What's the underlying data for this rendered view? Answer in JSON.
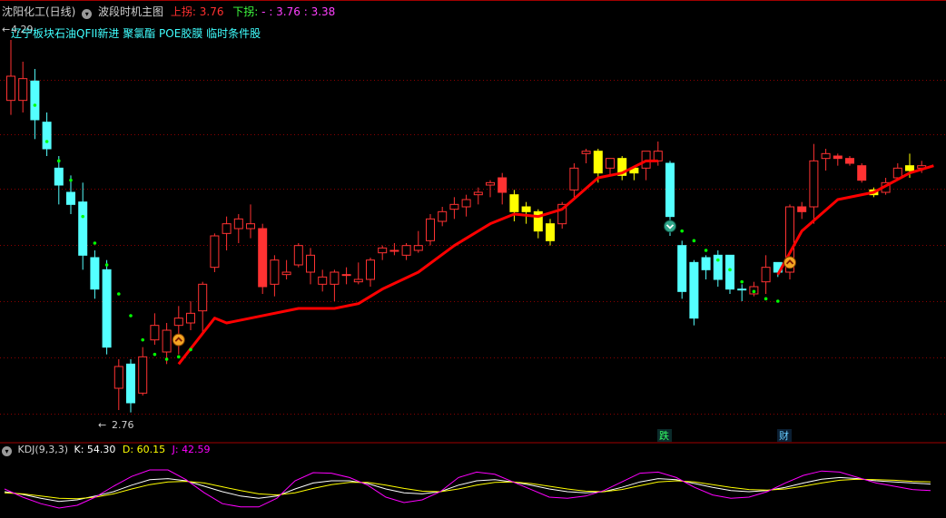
{
  "header": {
    "stock_name": "沈阳化工(日线)",
    "indicator_name": "波段时机主图",
    "up_label": "上拐:",
    "up_value": "3.76",
    "down_label": "下拐:",
    "down_value": "- : 3.76 : 3.38",
    "concept_tags": "辽宁板块石油QFII新进 聚氯酯 POE胶膜 临时条件股"
  },
  "main_chart": {
    "high_label": "4.29",
    "low_label": "2.76",
    "signal_labels": [
      "跌",
      "财"
    ]
  },
  "kdj_panel": {
    "title": "KDJ(9,3,3)",
    "k_label": "K:",
    "k_value": "54.30",
    "d_label": "D:",
    "d_value": "60.15",
    "j_label": "J:",
    "j_value": "42.59"
  },
  "colors": {
    "up_candle": "#ff3232",
    "down_candle": "#54ffff",
    "special_candle": "#ffff00",
    "trend_line": "#ff0000",
    "signal_dots": "#00ff00",
    "grid": "#8b0000",
    "k_line": "#ffffff",
    "d_line": "#ffff00",
    "j_line": "#ff00ff"
  },
  "chart_data": [
    {
      "type": "candlestick",
      "title": "沈阳化工(日线)",
      "ylim": [
        2.7,
        4.35
      ],
      "candles": [
        {
          "o": 4.14,
          "h": 4.29,
          "l": 3.98,
          "c": 4.04,
          "color": "up"
        },
        {
          "o": 4.04,
          "h": 4.2,
          "l": 3.99,
          "c": 4.13,
          "color": "up"
        },
        {
          "o": 4.12,
          "h": 4.17,
          "l": 3.88,
          "c": 3.96,
          "color": "down"
        },
        {
          "o": 3.95,
          "h": 3.99,
          "l": 3.81,
          "c": 3.84,
          "color": "down"
        },
        {
          "o": 3.76,
          "h": 3.81,
          "l": 3.61,
          "c": 3.69,
          "color": "down"
        },
        {
          "o": 3.66,
          "h": 3.73,
          "l": 3.57,
          "c": 3.61,
          "color": "down"
        },
        {
          "o": 3.62,
          "h": 3.7,
          "l": 3.34,
          "c": 3.4,
          "color": "down"
        },
        {
          "o": 3.39,
          "h": 3.42,
          "l": 3.22,
          "c": 3.26,
          "color": "down"
        },
        {
          "o": 3.34,
          "h": 3.38,
          "l": 2.99,
          "c": 3.02,
          "color": "down"
        },
        {
          "o": 2.94,
          "h": 2.97,
          "l": 2.76,
          "c": 2.85,
          "color": "up"
        },
        {
          "o": 2.95,
          "h": 2.97,
          "l": 2.75,
          "c": 2.79,
          "color": "down"
        },
        {
          "o": 2.83,
          "h": 3.02,
          "l": 2.82,
          "c": 2.98,
          "color": "up"
        },
        {
          "o": 3.05,
          "h": 3.16,
          "l": 3.03,
          "c": 3.11,
          "color": "up"
        },
        {
          "o": 3.09,
          "h": 3.12,
          "l": 2.95,
          "c": 3.0,
          "color": "up"
        },
        {
          "o": 3.11,
          "h": 3.19,
          "l": 2.99,
          "c": 3.14,
          "color": "up"
        },
        {
          "o": 3.12,
          "h": 3.21,
          "l": 3.09,
          "c": 3.16,
          "color": "up"
        },
        {
          "o": 3.17,
          "h": 3.29,
          "l": 3.08,
          "c": 3.28,
          "color": "up"
        },
        {
          "o": 3.35,
          "h": 3.49,
          "l": 3.33,
          "c": 3.48,
          "color": "up"
        },
        {
          "o": 3.53,
          "h": 3.56,
          "l": 3.42,
          "c": 3.49,
          "color": "up"
        },
        {
          "o": 3.51,
          "h": 3.57,
          "l": 3.45,
          "c": 3.55,
          "color": "up"
        },
        {
          "o": 3.53,
          "h": 3.61,
          "l": 3.47,
          "c": 3.51,
          "color": "up"
        },
        {
          "o": 3.51,
          "h": 3.53,
          "l": 3.24,
          "c": 3.27,
          "color": "up-solid"
        },
        {
          "o": 3.28,
          "h": 3.4,
          "l": 3.23,
          "c": 3.38,
          "color": "up"
        },
        {
          "o": 3.32,
          "h": 3.38,
          "l": 3.3,
          "c": 3.33,
          "color": "up"
        },
        {
          "o": 3.36,
          "h": 3.45,
          "l": 3.35,
          "c": 3.44,
          "color": "up"
        },
        {
          "o": 3.4,
          "h": 3.43,
          "l": 3.28,
          "c": 3.33,
          "color": "up"
        },
        {
          "o": 3.31,
          "h": 3.34,
          "l": 3.25,
          "c": 3.28,
          "color": "up"
        },
        {
          "o": 3.28,
          "h": 3.34,
          "l": 3.21,
          "c": 3.33,
          "color": "up"
        },
        {
          "o": 3.32,
          "h": 3.35,
          "l": 3.28,
          "c": 3.32,
          "color": "up"
        },
        {
          "o": 3.3,
          "h": 3.37,
          "l": 3.28,
          "c": 3.29,
          "color": "up"
        },
        {
          "o": 3.3,
          "h": 3.39,
          "l": 3.27,
          "c": 3.38,
          "color": "up"
        },
        {
          "o": 3.43,
          "h": 3.44,
          "l": 3.38,
          "c": 3.41,
          "color": "up"
        },
        {
          "o": 3.42,
          "h": 3.45,
          "l": 3.4,
          "c": 3.42,
          "color": "up"
        },
        {
          "o": 3.44,
          "h": 3.45,
          "l": 3.38,
          "c": 3.4,
          "color": "up"
        },
        {
          "o": 3.44,
          "h": 3.5,
          "l": 3.41,
          "c": 3.42,
          "color": "up"
        },
        {
          "o": 3.46,
          "h": 3.57,
          "l": 3.44,
          "c": 3.55,
          "color": "up"
        },
        {
          "o": 3.54,
          "h": 3.6,
          "l": 3.52,
          "c": 3.58,
          "color": "up"
        },
        {
          "o": 3.59,
          "h": 3.64,
          "l": 3.55,
          "c": 3.61,
          "color": "up"
        },
        {
          "o": 3.6,
          "h": 3.65,
          "l": 3.56,
          "c": 3.63,
          "color": "up"
        },
        {
          "o": 3.65,
          "h": 3.68,
          "l": 3.61,
          "c": 3.66,
          "color": "up"
        },
        {
          "o": 3.69,
          "h": 3.71,
          "l": 3.64,
          "c": 3.7,
          "color": "up"
        },
        {
          "o": 3.72,
          "h": 3.74,
          "l": 3.61,
          "c": 3.66,
          "color": "up-solid"
        },
        {
          "o": 3.65,
          "h": 3.67,
          "l": 3.54,
          "c": 3.58,
          "color": "yellow"
        },
        {
          "o": 3.6,
          "h": 3.62,
          "l": 3.53,
          "c": 3.58,
          "color": "yellow"
        },
        {
          "o": 3.58,
          "h": 3.59,
          "l": 3.47,
          "c": 3.5,
          "color": "yellow"
        },
        {
          "o": 3.53,
          "h": 3.55,
          "l": 3.44,
          "c": 3.46,
          "color": "yellow"
        },
        {
          "o": 3.53,
          "h": 3.62,
          "l": 3.51,
          "c": 3.61,
          "color": "up"
        },
        {
          "o": 3.67,
          "h": 3.78,
          "l": 3.64,
          "c": 3.76,
          "color": "up"
        },
        {
          "o": 3.83,
          "h": 3.84,
          "l": 3.78,
          "c": 3.82,
          "color": "up"
        },
        {
          "o": 3.83,
          "h": 3.84,
          "l": 3.7,
          "c": 3.74,
          "color": "yellow"
        },
        {
          "o": 3.76,
          "h": 3.8,
          "l": 3.73,
          "c": 3.8,
          "color": "up"
        },
        {
          "o": 3.8,
          "h": 3.81,
          "l": 3.71,
          "c": 3.73,
          "color": "yellow"
        },
        {
          "o": 3.76,
          "h": 3.77,
          "l": 3.71,
          "c": 3.74,
          "color": "yellow"
        },
        {
          "o": 3.83,
          "h": 3.83,
          "l": 3.71,
          "c": 3.76,
          "color": "up"
        },
        {
          "o": 3.79,
          "h": 3.87,
          "l": 3.77,
          "c": 3.83,
          "color": "up"
        },
        {
          "o": 3.78,
          "h": 3.79,
          "l": 3.48,
          "c": 3.56,
          "color": "down"
        },
        {
          "o": 3.44,
          "h": 3.46,
          "l": 3.22,
          "c": 3.25,
          "color": "down"
        },
        {
          "o": 3.37,
          "h": 3.38,
          "l": 3.11,
          "c": 3.14,
          "color": "down"
        },
        {
          "o": 3.39,
          "h": 3.4,
          "l": 3.3,
          "c": 3.34,
          "color": "down"
        },
        {
          "o": 3.4,
          "h": 3.42,
          "l": 3.27,
          "c": 3.3,
          "color": "down"
        },
        {
          "o": 3.4,
          "h": 3.4,
          "l": 3.24,
          "c": 3.26,
          "color": "down"
        },
        {
          "o": 3.26,
          "h": 3.28,
          "l": 3.21,
          "c": 3.26,
          "color": "down"
        },
        {
          "o": 3.24,
          "h": 3.29,
          "l": 3.23,
          "c": 3.27,
          "color": "up"
        },
        {
          "o": 3.29,
          "h": 3.4,
          "l": 3.24,
          "c": 3.35,
          "color": "up"
        },
        {
          "o": 3.37,
          "h": 3.37,
          "l": 3.31,
          "c": 3.33,
          "color": "down"
        },
        {
          "o": 3.33,
          "h": 3.61,
          "l": 3.3,
          "c": 3.6,
          "color": "up"
        },
        {
          "o": 3.6,
          "h": 3.62,
          "l": 3.55,
          "c": 3.58,
          "color": "up-solid"
        },
        {
          "o": 3.6,
          "h": 3.86,
          "l": 3.53,
          "c": 3.79,
          "color": "up"
        },
        {
          "o": 3.8,
          "h": 3.84,
          "l": 3.75,
          "c": 3.82,
          "color": "up"
        },
        {
          "o": 3.81,
          "h": 3.82,
          "l": 3.77,
          "c": 3.8,
          "color": "up-solid"
        },
        {
          "o": 3.8,
          "h": 3.81,
          "l": 3.77,
          "c": 3.78,
          "color": "up-solid"
        },
        {
          "o": 3.77,
          "h": 3.78,
          "l": 3.7,
          "c": 3.71,
          "color": "up-solid"
        },
        {
          "o": 3.67,
          "h": 3.68,
          "l": 3.64,
          "c": 3.65,
          "color": "yellow"
        },
        {
          "o": 3.66,
          "h": 3.72,
          "l": 3.65,
          "c": 3.7,
          "color": "up"
        },
        {
          "o": 3.72,
          "h": 3.78,
          "l": 3.71,
          "c": 3.76,
          "color": "up"
        },
        {
          "o": 3.77,
          "h": 3.82,
          "l": 3.72,
          "c": 3.75,
          "color": "yellow"
        },
        {
          "o": 3.76,
          "h": 3.79,
          "l": 3.74,
          "c": 3.77,
          "color": "up"
        }
      ],
      "trend_line": [
        {
          "i": 14,
          "v": 2.95
        },
        {
          "i": 17,
          "v": 3.14
        },
        {
          "i": 18,
          "v": 3.12
        },
        {
          "i": 20,
          "v": 3.14
        },
        {
          "i": 24,
          "v": 3.18
        },
        {
          "i": 27,
          "v": 3.18
        },
        {
          "i": 29,
          "v": 3.2
        },
        {
          "i": 31,
          "v": 3.26
        },
        {
          "i": 34,
          "v": 3.33
        },
        {
          "i": 37,
          "v": 3.44
        },
        {
          "i": 40,
          "v": 3.53
        },
        {
          "i": 42,
          "v": 3.57
        },
        {
          "i": 44,
          "v": 3.56
        },
        {
          "i": 46,
          "v": 3.59
        },
        {
          "i": 49,
          "v": 3.72
        },
        {
          "i": 51,
          "v": 3.74
        },
        {
          "i": 53,
          "v": 3.79
        },
        {
          "i": 54,
          "v": 3.79
        },
        {
          "i": 64,
          "v": 3.32
        },
        {
          "i": 66,
          "v": 3.5
        },
        {
          "i": 69,
          "v": 3.63
        },
        {
          "i": 72,
          "v": 3.66
        },
        {
          "i": 75,
          "v": 3.74
        },
        {
          "i": 77,
          "v": 3.77
        }
      ],
      "signal_dots": [
        {
          "i": 2,
          "v": 4.02
        },
        {
          "i": 3,
          "v": 3.87
        },
        {
          "i": 4,
          "v": 3.79
        },
        {
          "i": 5,
          "v": 3.71
        },
        {
          "i": 6,
          "v": 3.56
        },
        {
          "i": 7,
          "v": 3.45
        },
        {
          "i": 8,
          "v": 3.36
        },
        {
          "i": 9,
          "v": 3.24
        },
        {
          "i": 10,
          "v": 3.15
        },
        {
          "i": 11,
          "v": 3.05
        },
        {
          "i": 12,
          "v": 2.99
        },
        {
          "i": 13,
          "v": 2.97
        },
        {
          "i": 14,
          "v": 2.98
        },
        {
          "i": 15,
          "v": 3.01
        },
        {
          "i": 56,
          "v": 3.5
        },
        {
          "i": 57,
          "v": 3.46
        },
        {
          "i": 58,
          "v": 3.42
        },
        {
          "i": 59,
          "v": 3.38
        },
        {
          "i": 60,
          "v": 3.34
        },
        {
          "i": 61,
          "v": 3.29
        },
        {
          "i": 62,
          "v": 3.25
        },
        {
          "i": 63,
          "v": 3.22
        },
        {
          "i": 64,
          "v": 3.21
        }
      ],
      "up_markers": [
        {
          "i": 14,
          "v": 3.05
        },
        {
          "i": 65,
          "v": 3.37
        }
      ],
      "down_markers": [
        {
          "i": 55,
          "v": 3.52
        }
      ]
    },
    {
      "type": "line",
      "title": "KDJ(9,3,3)",
      "ylim": [
        0,
        100
      ],
      "series": [
        {
          "name": "K",
          "color": "#ffffff",
          "values": [
            40,
            35,
            28,
            22,
            25,
            32,
            40,
            52,
            62,
            64,
            60,
            50,
            40,
            32,
            28,
            32,
            45,
            56,
            60,
            60,
            55,
            45,
            38,
            36,
            40,
            52,
            60,
            62,
            58,
            52,
            45,
            40,
            38,
            40,
            48,
            58,
            64,
            62,
            55,
            48,
            42,
            40,
            42,
            48,
            56,
            63,
            66,
            64,
            60,
            58,
            56,
            54
          ]
        },
        {
          "name": "D",
          "color": "#ffff00",
          "values": [
            38,
            36,
            32,
            28,
            27,
            30,
            36,
            45,
            53,
            58,
            59,
            56,
            49,
            42,
            36,
            34,
            38,
            46,
            53,
            57,
            57,
            52,
            46,
            41,
            40,
            45,
            52,
            57,
            58,
            55,
            50,
            45,
            41,
            40,
            44,
            51,
            58,
            60,
            58,
            53,
            48,
            44,
            43,
            45,
            50,
            56,
            61,
            63,
            62,
            61,
            59,
            58
          ]
        },
        {
          "name": "J",
          "color": "#ff00ff",
          "values": [
            45,
            30,
            18,
            10,
            15,
            30,
            50,
            68,
            80,
            80,
            62,
            38,
            18,
            12,
            12,
            28,
            60,
            75,
            74,
            66,
            52,
            30,
            20,
            25,
            40,
            66,
            76,
            72,
            58,
            44,
            30,
            28,
            32,
            42,
            58,
            74,
            76,
            66,
            48,
            34,
            28,
            30,
            40,
            56,
            70,
            78,
            76,
            66,
            56,
            50,
            44,
            42
          ]
        }
      ]
    }
  ]
}
